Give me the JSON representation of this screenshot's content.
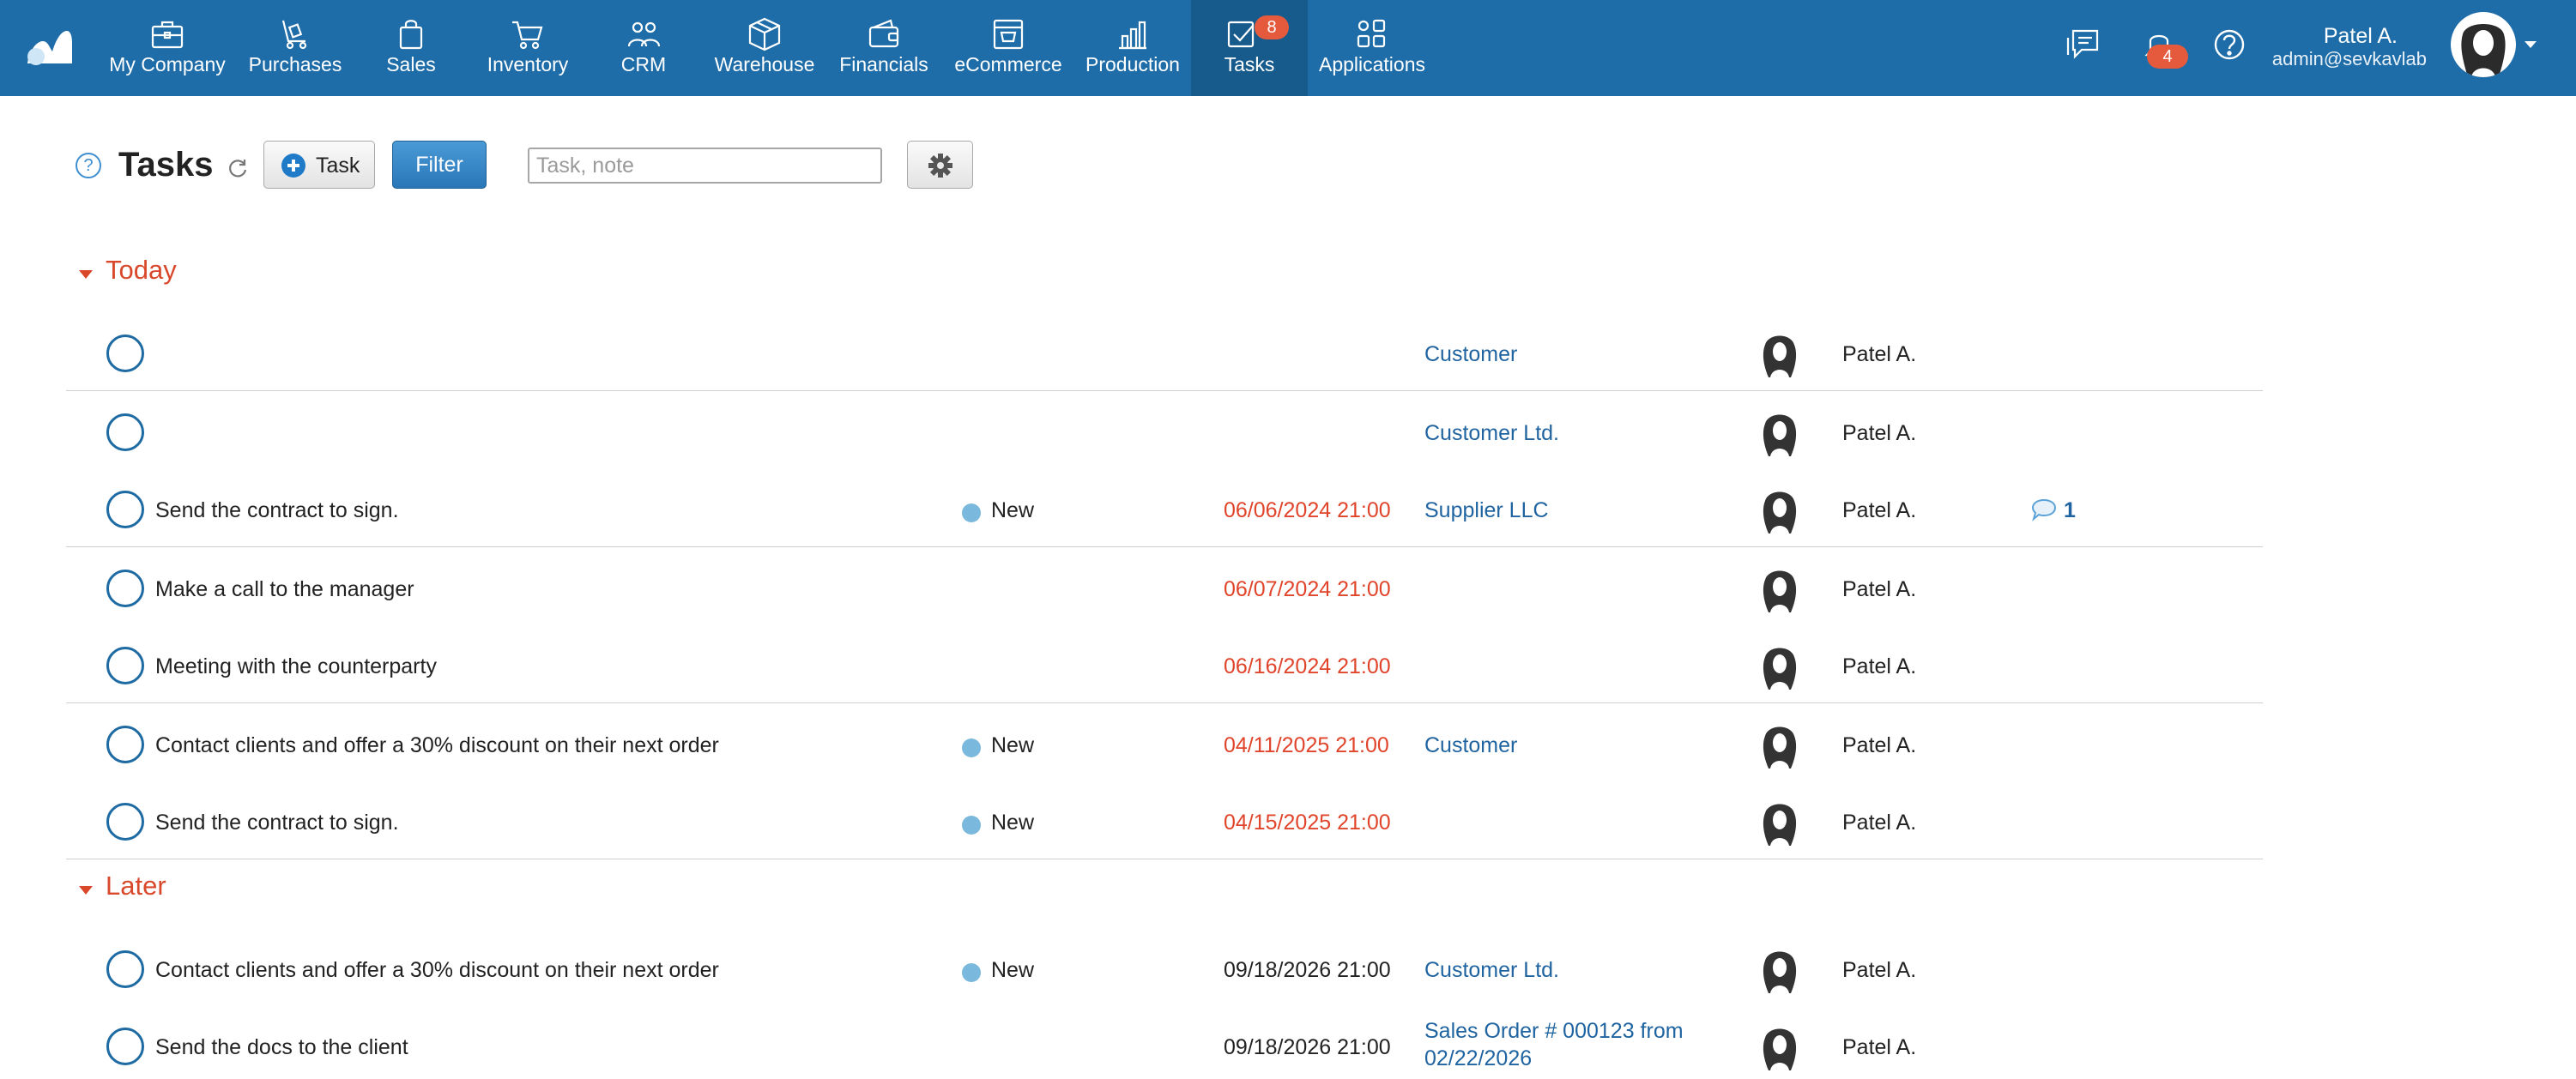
{
  "nav": {
    "items": [
      {
        "label": "My Company",
        "icon": "briefcase-icon"
      },
      {
        "label": "Purchases",
        "icon": "cart-dolly-icon"
      },
      {
        "label": "Sales",
        "icon": "shopping-bag-icon"
      },
      {
        "label": "Inventory",
        "icon": "shopping-cart-icon"
      },
      {
        "label": "CRM",
        "icon": "people-icon"
      },
      {
        "label": "Warehouse",
        "icon": "box-icon"
      },
      {
        "label": "Financials",
        "icon": "wallet-icon"
      },
      {
        "label": "eCommerce",
        "icon": "storefront-icon"
      },
      {
        "label": "Production",
        "icon": "bar-chart-icon"
      },
      {
        "label": "Tasks",
        "icon": "checkbox-icon",
        "badge": "8",
        "active": true
      },
      {
        "label": "Applications",
        "icon": "apps-grid-icon"
      }
    ],
    "notifications_badge": "4",
    "user": {
      "name": "Patel A.",
      "email": "admin@sevkavlab"
    }
  },
  "toolbar": {
    "help": "?",
    "title": "Tasks",
    "task_button": "Task",
    "filter_button": "Filter",
    "search_placeholder": "Task, note"
  },
  "sections": [
    {
      "title": "Today",
      "rows": [
        {
          "text": "",
          "status": "",
          "date": "",
          "link": "Customer",
          "assignee": "Patel A.",
          "comments": ""
        },
        {
          "text": "",
          "status": "",
          "date": "",
          "link": "Customer Ltd.",
          "assignee": "Patel A.",
          "comments": ""
        },
        {
          "text": "Send the contract to sign.",
          "status": "New",
          "date": "06/06/2024 21:00",
          "link": "Supplier LLC",
          "assignee": "Patel A.",
          "comments": "1"
        },
        {
          "text": "Make a call to the manager",
          "status": "",
          "date": "06/07/2024 21:00",
          "link": "",
          "assignee": "Patel A.",
          "comments": ""
        },
        {
          "text": "Meeting with the counterparty",
          "status": "",
          "date": "06/16/2024 21:00",
          "link": "",
          "assignee": "Patel A.",
          "comments": ""
        },
        {
          "text": "Contact clients and offer a 30% discount on their next order",
          "status": "New",
          "date": "04/11/2025 21:00",
          "link": "Customer",
          "assignee": "Patel A.",
          "comments": ""
        },
        {
          "text": "Send the contract to sign.",
          "status": "New",
          "date": "04/15/2025 21:00",
          "link": "",
          "assignee": "Patel A.",
          "comments": ""
        }
      ]
    },
    {
      "title": "Later",
      "rows": [
        {
          "text": "Contact clients and offer a 30% discount on their next order",
          "status": "New",
          "date": "09/18/2026 21:00",
          "link": "Customer Ltd.",
          "assignee": "Patel A.",
          "comments": ""
        },
        {
          "text": "Send the docs to the client",
          "status": "",
          "date": "09/18/2026 21:00",
          "link_line1": "Sales Order # 000123 from",
          "link_line2": "02/22/2026",
          "assignee": "Patel A.",
          "comments": ""
        }
      ]
    }
  ],
  "colors": {
    "nav_bg": "#1f6da8",
    "overdue": "#e0442a",
    "link": "#1f64a0",
    "section": "#d9482b",
    "badge": "#e55a3c"
  }
}
